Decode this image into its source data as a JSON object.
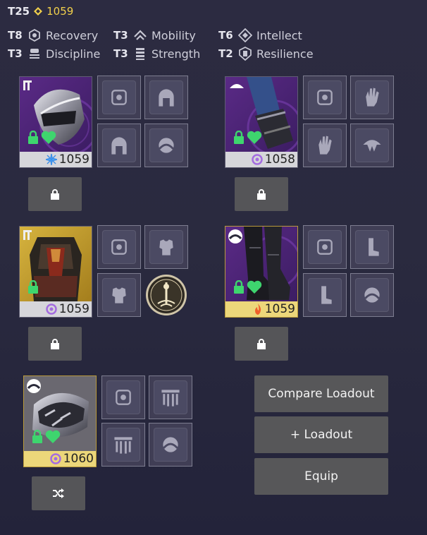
{
  "header": {
    "tier": "T25",
    "power": "1059",
    "power_color": "#f1d04b"
  },
  "stats": [
    {
      "tier": "T8",
      "name": "Recovery",
      "icon": "recovery-icon"
    },
    {
      "tier": "T3",
      "name": "Mobility",
      "icon": "mobility-icon"
    },
    {
      "tier": "T6",
      "name": "Intellect",
      "icon": "intellect-icon"
    },
    {
      "tier": "T3",
      "name": "Discipline",
      "icon": "discipline-icon"
    },
    {
      "tier": "T3",
      "name": "Strength",
      "icon": "strength-icon"
    },
    {
      "tier": "T2",
      "name": "Resilience",
      "icon": "resilience-icon"
    }
  ],
  "items": {
    "helmet": {
      "power": "1059",
      "element": "stasis-icon",
      "element_color": "#4aa8ff",
      "locked": true,
      "favorited": true,
      "rarity": "legendary"
    },
    "gauntlets": {
      "power": "1058",
      "element": "void-icon",
      "element_color": "#a46ce0",
      "locked": true,
      "favorited": true,
      "rarity": "legendary"
    },
    "chest": {
      "power": "1059",
      "element": "void-icon",
      "element_color": "#a46ce0",
      "locked": true,
      "favorited": false,
      "rarity": "exotic"
    },
    "legs": {
      "power": "1059",
      "element": "solar-icon",
      "element_color": "#f0602a",
      "locked": true,
      "favorited": true,
      "rarity": "exotic"
    },
    "class_item": {
      "power": "1060",
      "element": "void-icon",
      "element_color": "#a46ce0",
      "locked": true,
      "favorited": true,
      "rarity": "exotic"
    }
  },
  "buttons": {
    "compare": "Compare Loadout",
    "add_loadout": "+ Loadout",
    "equip": "Equip"
  },
  "colors": {
    "lock_green": "#3ed56e",
    "background": "#2b2a40"
  }
}
